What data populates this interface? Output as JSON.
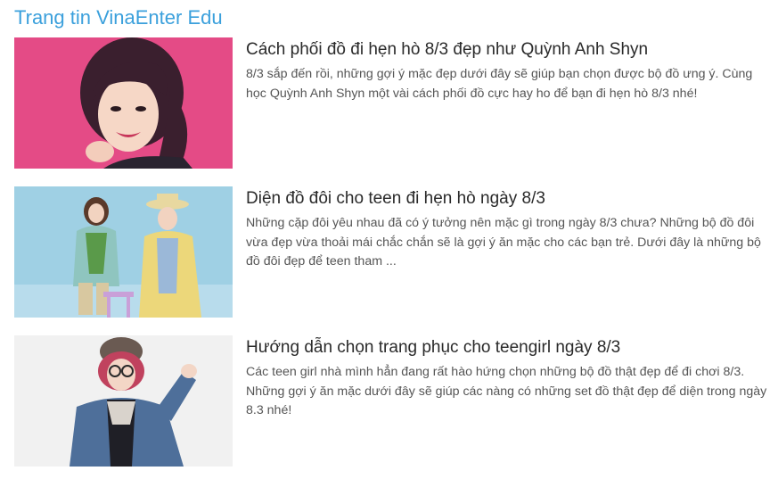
{
  "section": {
    "title": "Trang tin VinaEnter Edu"
  },
  "articles": [
    {
      "title": "Cách phối đồ đi hẹn hò 8/3 đẹp như Quỳnh Anh Shyn",
      "excerpt": "8/3 sắp đến rồi, những gợi ý mặc đẹp dưới đây sẽ giúp bạn chọn được bộ đồ ưng ý. Cùng học Quỳnh Anh Shyn một vài cách phối đồ cực hay ho để bạn đi hẹn hò 8/3 nhé!"
    },
    {
      "title": "Diện đồ đôi cho teen đi hẹn hò ngày 8/3",
      "excerpt": "Những cặp đôi yêu nhau đã có ý tưởng nên mặc gì trong ngày 8/3 chưa? Những bộ đồ đôi vừa đẹp vừa thoải mái chắc chắn sẽ là gợi ý ăn mặc cho các bạn trẻ. Dưới đây là những bộ đồ đôi đẹp để teen tham ..."
    },
    {
      "title": "Hướng dẫn chọn trang phục cho teengirl ngày 8/3",
      "excerpt": "Các teen girl nhà mình hẳn đang rất hào hứng chọn những bộ đồ thật đẹp để đi chơi 8/3. Những gợi ý ăn mặc dưới đây sẽ giúp các nàng có những set đồ thật đẹp để diện trong ngày 8.3 nhé!"
    }
  ]
}
